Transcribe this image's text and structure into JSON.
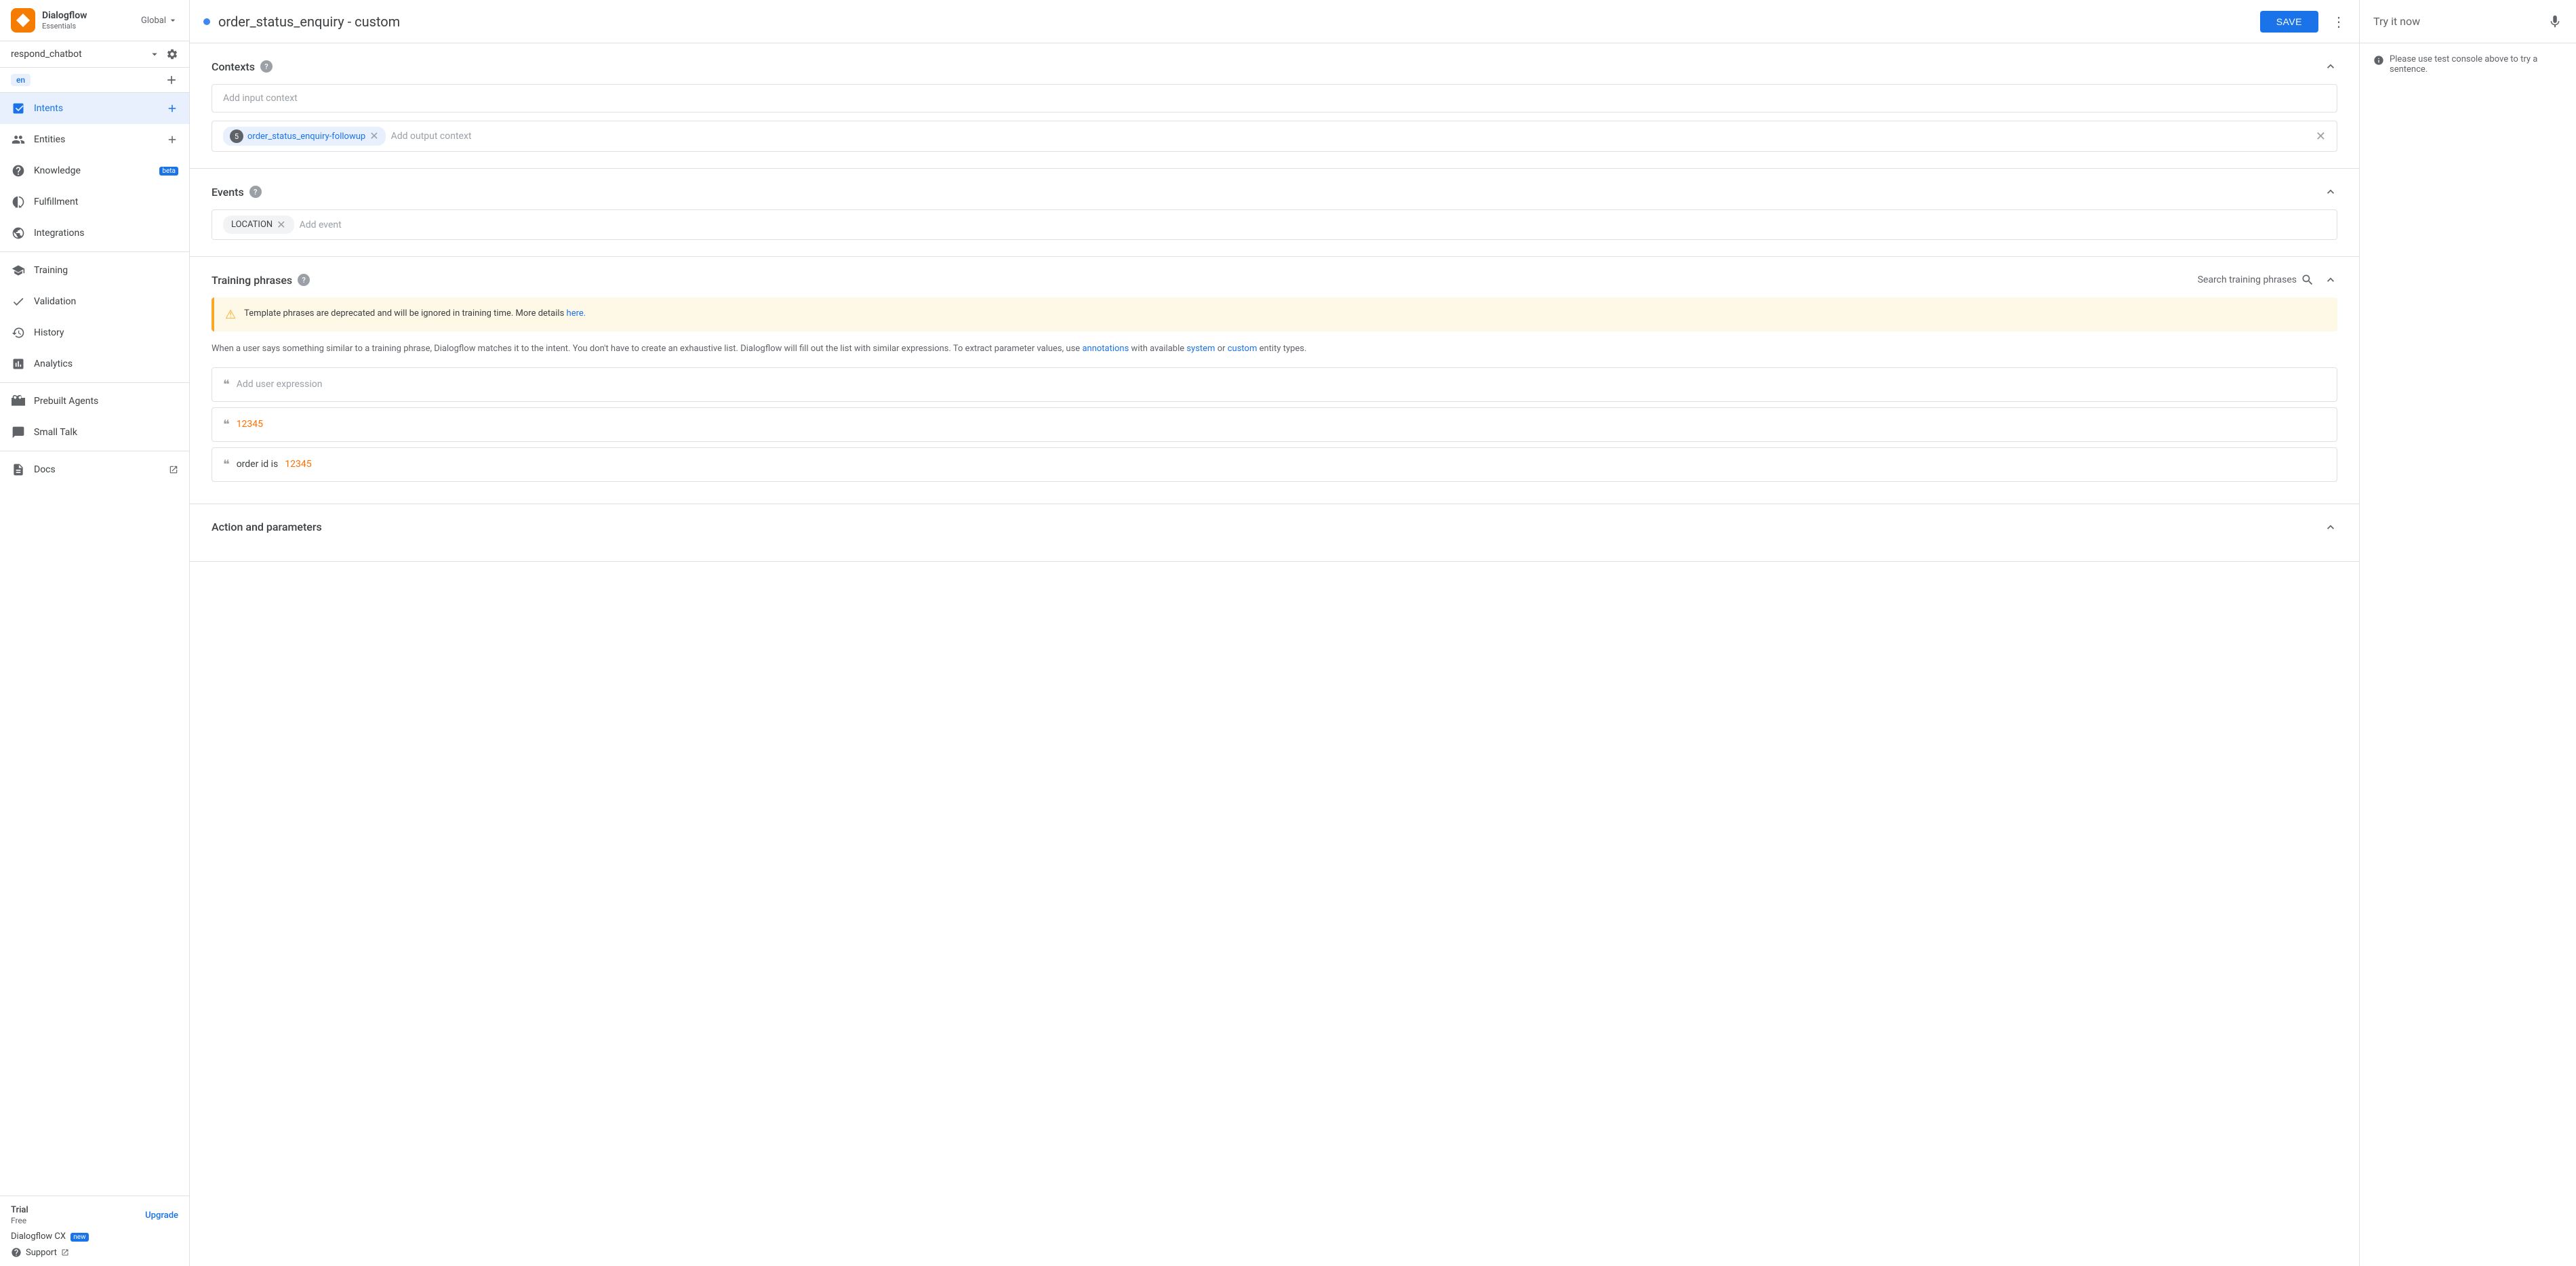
{
  "sidebar": {
    "brand": {
      "name": "Dialogflow",
      "sub": "Essentials"
    },
    "global_label": "Global",
    "agent_name": "respond_chatbot",
    "lang": "en",
    "nav_items": [
      {
        "id": "intents",
        "label": "Intents",
        "icon": "intents-icon",
        "active": true,
        "has_add": true
      },
      {
        "id": "entities",
        "label": "Entities",
        "icon": "entities-icon",
        "active": false,
        "has_add": true
      },
      {
        "id": "knowledge",
        "label": "Knowledge",
        "icon": "knowledge-icon",
        "active": false,
        "badge": "beta"
      },
      {
        "id": "fulfillment",
        "label": "Fulfillment",
        "icon": "fulfillment-icon",
        "active": false
      },
      {
        "id": "integrations",
        "label": "Integrations",
        "icon": "integrations-icon",
        "active": false
      },
      {
        "id": "training",
        "label": "Training",
        "icon": "training-icon",
        "active": false
      },
      {
        "id": "validation",
        "label": "Validation",
        "icon": "validation-icon",
        "active": false
      },
      {
        "id": "history",
        "label": "History",
        "icon": "history-icon",
        "active": false
      },
      {
        "id": "analytics",
        "label": "Analytics",
        "icon": "analytics-icon",
        "active": false
      },
      {
        "id": "prebuilt-agents",
        "label": "Prebuilt Agents",
        "icon": "prebuilt-icon",
        "active": false
      },
      {
        "id": "small-talk",
        "label": "Small Talk",
        "icon": "talk-icon",
        "active": false
      },
      {
        "id": "docs",
        "label": "Docs",
        "icon": "docs-icon",
        "active": false,
        "external": true
      }
    ],
    "trial": {
      "label": "Trial",
      "plan": "Free",
      "upgrade": "Upgrade"
    },
    "dialogflow_cx": "Dialogflow CX",
    "new_badge": "new",
    "support": "Support"
  },
  "topbar": {
    "title": "order_status_enquiry - custom",
    "save_label": "SAVE",
    "dot_color": "#4285f4"
  },
  "try_panel": {
    "label": "Try it now",
    "info_text": "Please use test console above to try a sentence."
  },
  "sections": {
    "contexts": {
      "title": "Contexts",
      "input_placeholder": "Add input context",
      "output_context_num": "5",
      "output_context_name": "order_status_enquiry-followup",
      "output_placeholder": "Add output context"
    },
    "events": {
      "title": "Events",
      "event_name": "LOCATION",
      "event_placeholder": "Add event"
    },
    "training_phrases": {
      "title": "Training phrases",
      "search_placeholder": "Search training phrases",
      "warning": "Template phrases are deprecated and will be ignored in training time. More details",
      "warning_link": "here.",
      "info": "When a user says something similar to a training phrase, Dialogflow matches it to the intent. You don't have to create an exhaustive list. Dialogflow will fill out the list with similar expressions. To extract parameter values, use",
      "info_link1": "annotations",
      "info_mid": "with available",
      "info_link2": "system",
      "info_or": "or",
      "info_link3": "custom",
      "info_end": "entity types.",
      "add_expression_placeholder": "Add user expression",
      "phrases": [
        {
          "id": 1,
          "text": "12345",
          "highlight": "12345",
          "pre": "",
          "post": ""
        },
        {
          "id": 2,
          "text": "order id is 12345",
          "highlight": "12345",
          "pre": "order id is ",
          "post": ""
        }
      ]
    },
    "action_params": {
      "title": "Action and parameters"
    }
  }
}
